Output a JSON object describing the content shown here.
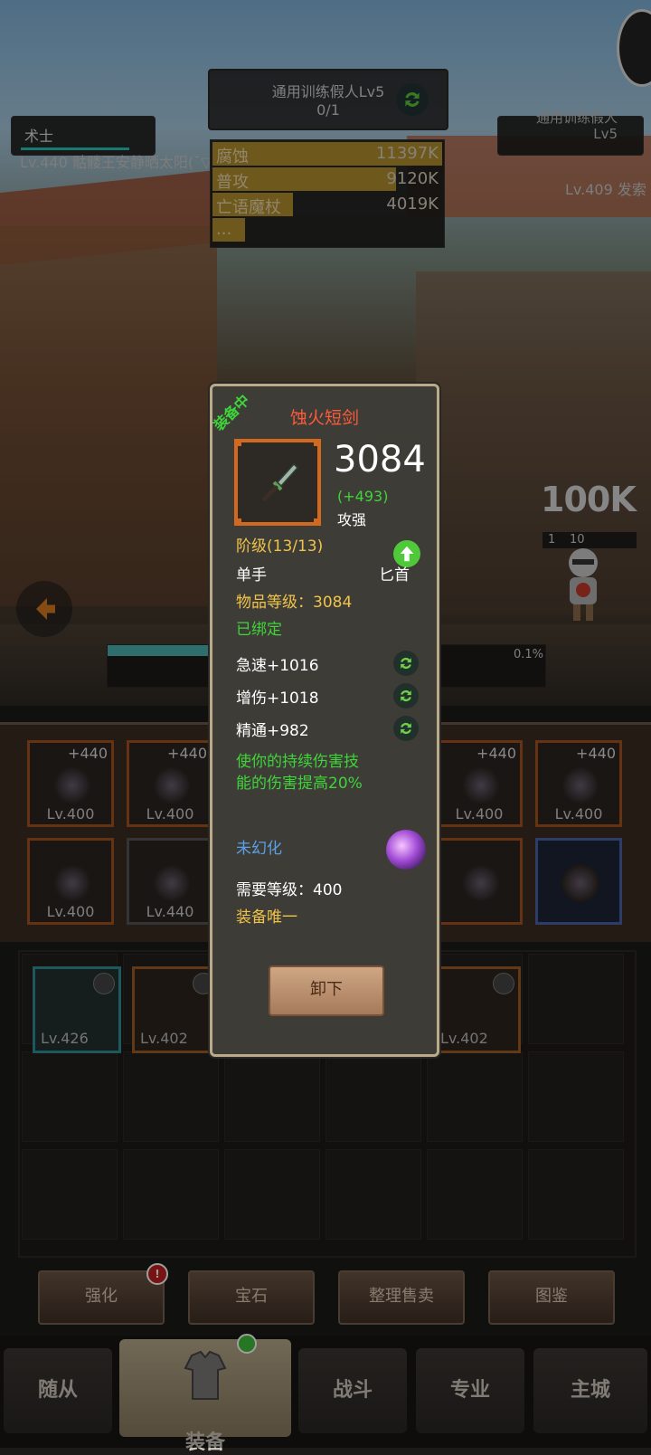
{
  "hud": {
    "target_title": "通用训练假人Lv5",
    "target_progress": "0/1",
    "player_class": "术士",
    "player_name": "Lv.440 骷髅王安静晒太阳(ˉ▽ˉ)～",
    "enemy_title1": "通用训练假人",
    "enemy_title2": "Lv5",
    "enemy_name": "Lv.409 发索",
    "damage_rows": [
      {
        "name": "腐蚀",
        "value": "11397K",
        "fraction": 1.0
      },
      {
        "name": "普攻",
        "value": "9120K",
        "fraction": 0.8
      },
      {
        "name": "亡语魔杖",
        "value": "4019K",
        "fraction": 0.35
      },
      {
        "name": "...",
        "value": "",
        "fraction": 0.14
      }
    ],
    "floating_damage": "100K",
    "enemy_level_1": "1",
    "enemy_level_2": "10",
    "progress_percent": "0.1%"
  },
  "equipment_slots": [
    {
      "plus": "+440",
      "level": "Lv.400",
      "style": "orange"
    },
    {
      "plus": "+440",
      "level": "Lv.400",
      "style": "orange"
    },
    {
      "plus": "+440",
      "level": "Lv.400",
      "style": "orange"
    },
    {
      "plus": "+440",
      "level": "Lv.400",
      "style": "orange"
    },
    {
      "plus": "",
      "level": "Lv.400",
      "style": "orange"
    },
    {
      "plus": "",
      "level": "Lv.440",
      "style": "grey"
    },
    {
      "plus": "",
      "level": "",
      "style": "orange"
    },
    {
      "plus": "",
      "level": "",
      "style": "blue"
    }
  ],
  "bag_items": [
    {
      "level": "Lv.426",
      "style": "teal"
    },
    {
      "level": "Lv.402",
      "style": "orange"
    },
    {
      "level": "Lv.402",
      "style": "orange"
    }
  ],
  "actions": {
    "enhance": "强化",
    "gem": "宝石",
    "sort_sell": "整理售卖",
    "codex": "图鉴",
    "enhance_badge": "!"
  },
  "nav": {
    "followers": "随从",
    "equipment": "装备",
    "battle": "战斗",
    "profession": "专业",
    "main_city": "主城"
  },
  "popup": {
    "equipped_tag": "装备中",
    "item_name": "蚀火短剑",
    "score": "3084",
    "score_delta": "(+493)",
    "score_type": "攻强",
    "tier": "阶级(13/13)",
    "hand": "单手",
    "weapon_type": "匕首",
    "item_level": "物品等级：3084",
    "bound": "已绑定",
    "stats": [
      "急速+1016",
      "增伤+1018",
      "精通+982"
    ],
    "effect_line1": "使你的持续伤害技",
    "effect_line2": "能的伤害提高20%",
    "transmog": "未幻化",
    "required_level": "需要等级：400",
    "unique": "装备唯一",
    "unequip": "卸下"
  }
}
